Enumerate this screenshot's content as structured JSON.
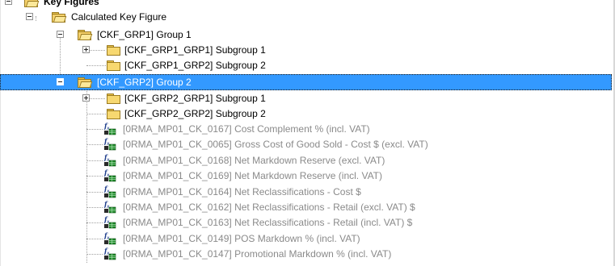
{
  "tree": {
    "root": {
      "label": "Key Figures",
      "expanded": true
    },
    "calculated": {
      "label": "Calculated Key Figure",
      "expanded": true
    },
    "group1": {
      "label": "[CKF_GRP1] Group 1",
      "children": [
        {
          "label": "[CKF_GRP1_GRP1] Subgroup 1",
          "expandable": true
        },
        {
          "label": "[CKF_GRP1_GRP2] Subgroup 2",
          "expandable": false
        }
      ]
    },
    "group2": {
      "label": "[CKF_GRP2] Group 2",
      "selected": true,
      "subgroups": [
        {
          "label": "[CKF_GRP2_GRP1] Subgroup 1",
          "expandable": true
        },
        {
          "label": "[CKF_GRP2_GRP2] Subgroup 2",
          "expandable": false
        }
      ],
      "key_figures": [
        {
          "label": "[0RMA_MP01_CK_0167] Cost Complement % (incl. VAT)"
        },
        {
          "label": "[0RMA_MP01_CK_0065] Gross Cost of Good Sold - Cost $ (excl. VAT)"
        },
        {
          "label": "[0RMA_MP01_CK_0168] Net Markdown Reserve (excl. VAT)"
        },
        {
          "label": "[0RMA_MP01_CK_0169] Net Markdown Reserve (incl. VAT)"
        },
        {
          "label": "[0RMA_MP01_CK_0164] Net Reclassifications - Cost $"
        },
        {
          "label": "[0RMA_MP01_CK_0162] Net Reclassifications - Retail (excl. VAT) $"
        },
        {
          "label": "[0RMA_MP01_CK_0163] Net Reclassifications - Retail (incl. VAT) $"
        },
        {
          "label": "[0RMA_MP01_CK_0149] POS Markdown % (incl. VAT)"
        },
        {
          "label": "[0RMA_MP01_CK_0147] Promotional Markdown % (incl. VAT)"
        }
      ]
    },
    "colors": {
      "selection": "#3399ff",
      "folder": "#f7d870",
      "disabled_text": "#8a8a8a"
    },
    "icons": {
      "folder": "folder-icon",
      "folder_open": "open-folder-icon",
      "key_figure": "calculated-key-figure-icon",
      "expander": "plus-minus-expander-icon"
    }
  }
}
